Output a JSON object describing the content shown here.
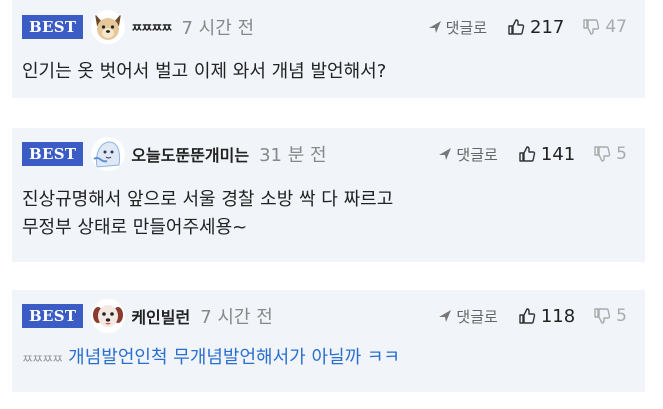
{
  "comments": [
    {
      "badge": "BEST",
      "nickname": "ㅉㅉㅉㅉ",
      "time": "7 시간 전",
      "reply_label": "댓글로",
      "likes": "217",
      "dislikes": "47",
      "text_lines": [
        "인기는 옷 벗어서 벌고 이제 와서 개념 발언해서?"
      ],
      "avatar_icon": "dog-avatar-icon"
    },
    {
      "badge": "BEST",
      "nickname": "오늘도뚠뚠개미는",
      "time": "31 분 전",
      "reply_label": "댓글로",
      "likes": "141",
      "dislikes": "5",
      "text_lines": [
        "진상규명해서 앞으로 서울 경찰 소방 싹 다 짜르고",
        "무정부 상태로 만들어주세용~"
      ],
      "avatar_icon": "ghost-avatar-icon"
    },
    {
      "badge": "BEST",
      "nickname": "케인빌런",
      "time": "7 시간 전",
      "reply_label": "댓글로",
      "likes": "118",
      "dislikes": "5",
      "mention": "ㅉㅉㅉㅉ",
      "text": "개념발언인척 무개념발언해서가 아닐까 ㅋㅋ",
      "avatar_icon": "puppy-avatar-icon"
    }
  ],
  "colors": {
    "badge_bg": "#3b5cc4",
    "card_bg": "#f1f4f8",
    "link_blue": "#2a6fd0"
  }
}
